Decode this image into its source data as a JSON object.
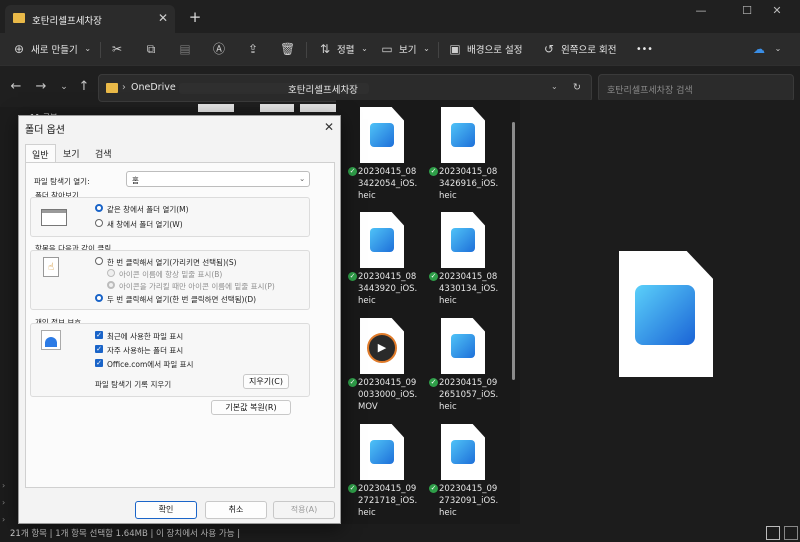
{
  "window": {
    "tab_title": "호탄리셀프세차장",
    "close_tab": "✕",
    "new_tab": "+",
    "min": "—",
    "max": "☐",
    "close": "✕"
  },
  "toolbar": {
    "new": "새로 만들기",
    "sort": "정렬",
    "view": "보기",
    "background": "배경으로 설정",
    "rotate_left": "왼쪽으로 회전",
    "more": "•••"
  },
  "addressbar": {
    "onedrive": "OneDrive",
    "folder": "호탄리셀프세차장",
    "search_placeholder": "호탄리셀프세차장 검색"
  },
  "navpane": {
    "item": "11 공부"
  },
  "files": [
    {
      "name": "20230415_083422054_iOS.heic",
      "type": "image"
    },
    {
      "name": "20230415_083426916_iOS.heic",
      "type": "image"
    },
    {
      "name": "20230415_083443920_iOS.heic",
      "type": "image"
    },
    {
      "name": "20230415_084330134_iOS.heic",
      "type": "image"
    },
    {
      "name": "20230415_090033000_iOS.MOV",
      "type": "video"
    },
    {
      "name": "20230415_092651057_iOS.heic",
      "type": "image"
    },
    {
      "name": "20230415_092721718_iOS.heic",
      "type": "image"
    },
    {
      "name": "20230415_092732091_iOS.heic",
      "type": "image"
    }
  ],
  "status": {
    "text": "21개 항목  |  1개 항목 선택함 1.64MB  |  이 장치에서 사용 가능  |"
  },
  "dialog": {
    "title": "폴더 옵션",
    "tabs": [
      "일반",
      "보기",
      "검색"
    ],
    "open_label": "파일 탐색기 열기:",
    "open_value": "홈",
    "browse_group": "폴더 찾아보기",
    "browse_same": "같은 창에서 폴더 열기(M)",
    "browse_new": "새 창에서 폴더 열기(W)",
    "click_group": "항목을 다음과 같이 클릭",
    "single_click": "한 번 클릭해서 열기(가리키면 선택됨)(S)",
    "underline_always": "아이콘 이름에 항상 밑줄 표시(B)",
    "underline_hover": "아이콘을 가리킬 때만 아이콘 이름에 밑줄 표시(P)",
    "double_click": "두 번 클릭해서 열기(한 번 클릭하면 선택됨)(D)",
    "privacy_group": "개인 정보 보호",
    "recent_files": "최근에 사용한 파일 표시",
    "frequent_folders": "자주 사용하는 폴더 표시",
    "office_files": "Office.com에서 파일 표시",
    "clear_label": "파일 탐색기 기록 지우기",
    "clear_button": "지우기(C)",
    "restore_button": "기본값 복원(R)",
    "ok": "확인",
    "cancel": "취소",
    "apply": "적용(A)"
  }
}
